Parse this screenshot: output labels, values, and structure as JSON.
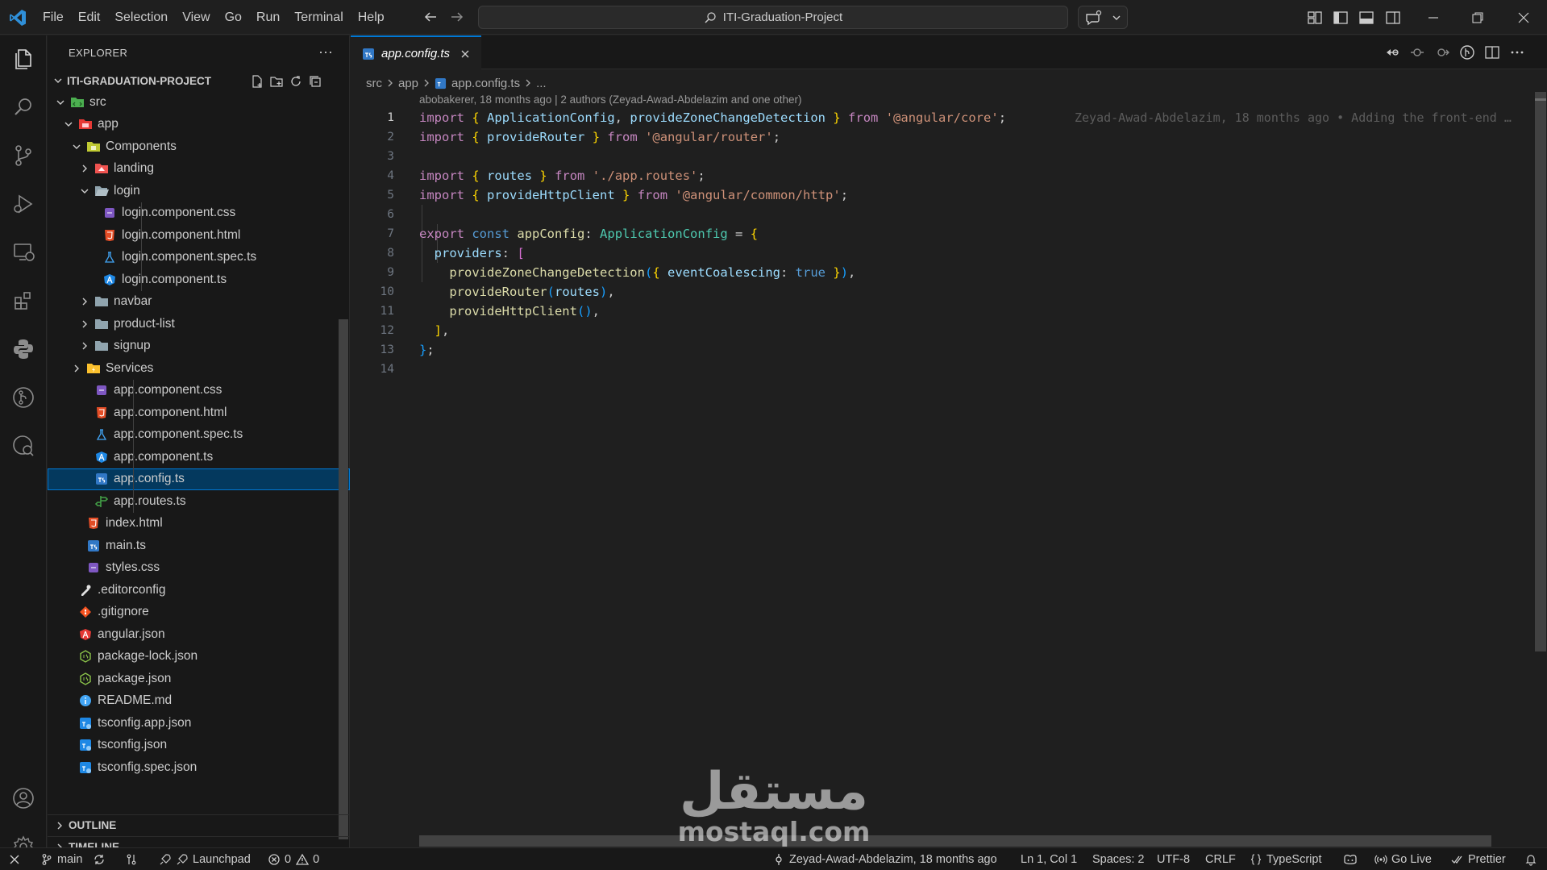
{
  "menu": [
    "File",
    "Edit",
    "Selection",
    "View",
    "Go",
    "Run",
    "Terminal",
    "Help"
  ],
  "search": {
    "label": "ITI-Graduation-Project"
  },
  "explorer": {
    "title": "EXPLORER",
    "more": "···",
    "project": "ITI-GRADUATION-PROJECT",
    "tree": [
      {
        "label": "src",
        "icon": "folder-src-icon"
      },
      {
        "label": "app",
        "icon": "folder-app-icon"
      },
      {
        "label": "Components",
        "icon": "folder-components-icon"
      },
      {
        "label": "landing",
        "icon": "folder-landing-icon"
      },
      {
        "label": "login",
        "icon": "folder-open-icon"
      },
      {
        "label": "login.component.css",
        "icon": "css-file-icon"
      },
      {
        "label": "login.component.html",
        "icon": "html-file-icon"
      },
      {
        "label": "login.component.spec.ts",
        "icon": "test-file-icon"
      },
      {
        "label": "login.component.ts",
        "icon": "angular-file-icon"
      },
      {
        "label": "navbar",
        "icon": "folder-icon"
      },
      {
        "label": "product-list",
        "icon": "folder-icon"
      },
      {
        "label": "signup",
        "icon": "folder-icon"
      },
      {
        "label": "Services",
        "icon": "folder-services-icon"
      },
      {
        "label": "app.component.css",
        "icon": "css-file-icon"
      },
      {
        "label": "app.component.html",
        "icon": "html-file-icon"
      },
      {
        "label": "app.component.spec.ts",
        "icon": "test-file-icon"
      },
      {
        "label": "app.component.ts",
        "icon": "angular-file-icon"
      },
      {
        "label": "app.config.ts",
        "icon": "ts-file-icon"
      },
      {
        "label": "app.routes.ts",
        "icon": "routes-file-icon"
      },
      {
        "label": "index.html",
        "icon": "html-file-icon"
      },
      {
        "label": "main.ts",
        "icon": "ts-file-icon"
      },
      {
        "label": "styles.css",
        "icon": "css-file-icon"
      },
      {
        "label": ".editorconfig",
        "icon": "editorconfig-icon"
      },
      {
        "label": ".gitignore",
        "icon": "git-icon"
      },
      {
        "label": "angular.json",
        "icon": "angular-json-icon"
      },
      {
        "label": "package-lock.json",
        "icon": "node-icon"
      },
      {
        "label": "package.json",
        "icon": "node-icon"
      },
      {
        "label": "README.md",
        "icon": "info-icon"
      },
      {
        "label": "tsconfig.app.json",
        "icon": "tsconfig-icon"
      },
      {
        "label": "tsconfig.json",
        "icon": "tsconfig-icon"
      },
      {
        "label": "tsconfig.spec.json",
        "icon": "tsconfig-icon"
      }
    ],
    "outline": "OUTLINE",
    "timeline": "TIMELINE"
  },
  "editor": {
    "tab": "app.config.ts",
    "breadcrumb": [
      "src",
      "app",
      "app.config.ts",
      "..."
    ],
    "blame_header": "abobakerer, 18 months ago | 2 authors (Zeyad-Awad-Abdelazim and one other)",
    "inline_blame": "Zeyad-Awad-Abdelazim, 18 months ago • Adding the front-end …",
    "line_numbers": [
      "1",
      "2",
      "3",
      "4",
      "5",
      "6",
      "7",
      "8",
      "9",
      "10",
      "11",
      "12",
      "13",
      "14"
    ],
    "code": [
      "import { ApplicationConfig, provideZoneChangeDetection } from '@angular/core';",
      "import { provideRouter } from '@angular/router';",
      "",
      "import { routes } from './app.routes';",
      "import { provideHttpClient } from '@angular/common/http';",
      "",
      "export const appConfig: ApplicationConfig = {",
      "  providers: [",
      "    provideZoneChangeDetection({ eventCoalescing: true }),",
      "    provideRouter(routes),",
      "    provideHttpClient(),",
      "  ],",
      "};",
      ""
    ]
  },
  "watermark": {
    "arabic": "مستقل",
    "latin": "mostaql.com"
  },
  "status": {
    "branch": "main",
    "launchpad": "Launchpad",
    "errors": "0",
    "warnings": "0",
    "blame": "Zeyad-Awad-Abdelazim, 18 months ago",
    "position": "Ln 1, Col 1",
    "spaces": "Spaces: 2",
    "encoding": "UTF-8",
    "eol": "CRLF",
    "language": "TypeScript",
    "golive": "Go Live",
    "prettier": "Prettier"
  }
}
